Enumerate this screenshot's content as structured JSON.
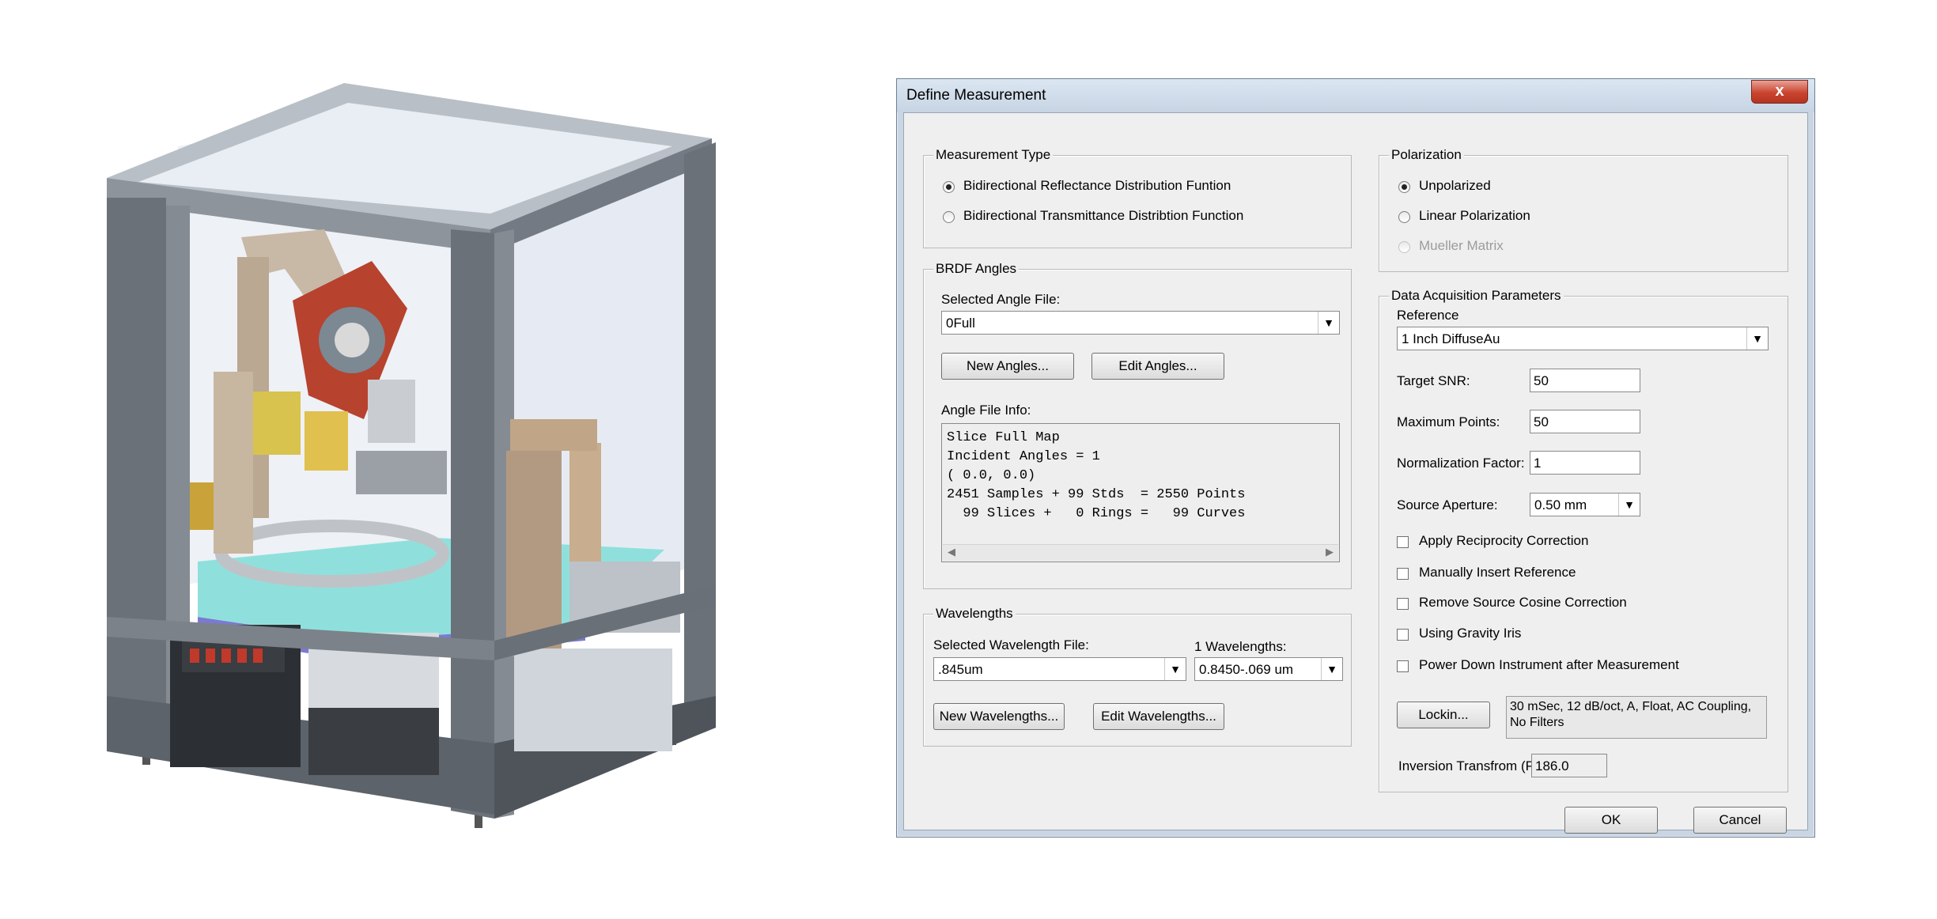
{
  "dialog": {
    "title": "Define Measurement",
    "close_glyph": "x",
    "measurement_type": {
      "legend": "Measurement Type",
      "options": [
        {
          "label": "Bidirectional Reflectance Distribution Funtion",
          "selected": true
        },
        {
          "label": "Bidirectional Transmittance Distribtion Function",
          "selected": false
        }
      ]
    },
    "polarization": {
      "legend": "Polarization",
      "options": [
        {
          "label": "Unpolarized",
          "selected": true
        },
        {
          "label": "Linear Polarization",
          "selected": false
        },
        {
          "label": "Mueller Matrix",
          "selected": false,
          "disabled": true
        }
      ]
    },
    "brdf_angles": {
      "legend": "BRDF Angles",
      "selected_file_label": "Selected Angle File:",
      "selected_file_value": "0Full",
      "new_button": "New Angles...",
      "edit_button": "Edit Angles...",
      "info_label": "Angle File Info:",
      "info_lines": [
        "Slice Full Map",
        "Incident Angles = 1",
        "( 0.0, 0.0)",
        "2451 Samples + 99 Stds  = 2550 Points",
        "  99 Slices +   0 Rings =   99 Curves"
      ]
    },
    "wavelengths": {
      "legend": "Wavelengths",
      "selected_file_label": "Selected Wavelength File:",
      "selected_file_value": ".845um",
      "count_label": "1  Wavelengths:",
      "count_value": "0.8450-.069 um",
      "new_button": "New Wavelengths...",
      "edit_button": "Edit Wavelengths..."
    },
    "acquisition": {
      "legend": "Data Acquisition Parameters",
      "reference_label": "Reference",
      "reference_value": "1 Inch DiffuseAu",
      "target_snr_label": "Target SNR:",
      "target_snr_value": "50",
      "max_points_label": "Maximum Points:",
      "max_points_value": "50",
      "normalization_label": "Normalization Factor:",
      "normalization_value": "1",
      "aperture_label": "Source Aperture:",
      "aperture_value": "0.50 mm",
      "checkboxes": [
        {
          "label": "Apply Reciprocity Correction",
          "checked": false
        },
        {
          "label": "Manually Insert Reference",
          "checked": false
        },
        {
          "label": "Remove Source Cosine Correction",
          "checked": false
        },
        {
          "label": "Using Gravity Iris",
          "checked": false
        },
        {
          "label": "Power Down Instrument after Measurement",
          "checked": false
        }
      ],
      "lockin_button": "Lockin...",
      "lockin_info": "30 mSec, 12 dB/oct, A, Float, AC Coupling, No Filters",
      "inversion_label": "Inversion Transfrom (PhiR):",
      "inversion_value": "186.0"
    },
    "ok_button": "OK",
    "cancel_button": "Cancel"
  }
}
